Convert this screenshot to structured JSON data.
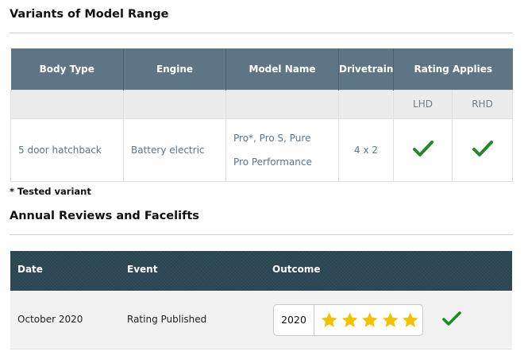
{
  "variants": {
    "title": "Variants of Model Range",
    "headers": [
      "Body Type",
      "Engine",
      "Model Name",
      "Drivetrain",
      "Rating Applies"
    ],
    "subheaders": [
      "LHD",
      "RHD"
    ],
    "rows": [
      {
        "body_type": "5 door hatchback",
        "engine": "Battery electric",
        "model_names": [
          "Pro*, Pro S, Pure",
          "Pro Performance"
        ],
        "drivetrain": "4 x 2",
        "lhd": "check-icon",
        "rhd": "check-icon"
      }
    ],
    "footnote": "* Tested variant"
  },
  "reviews": {
    "title": "Annual Reviews and Facelifts",
    "headers": [
      "Date",
      "Event",
      "Outcome"
    ],
    "rows": [
      {
        "date": "October 2020",
        "event": "Rating Published",
        "year": "2020",
        "stars": 5,
        "status": "check-icon"
      }
    ]
  },
  "colors": {
    "header_blue": "#5e7585",
    "header_dark": "#2c4754",
    "check_green": "#1f8a2a",
    "star_yellow": "#f2c200"
  }
}
